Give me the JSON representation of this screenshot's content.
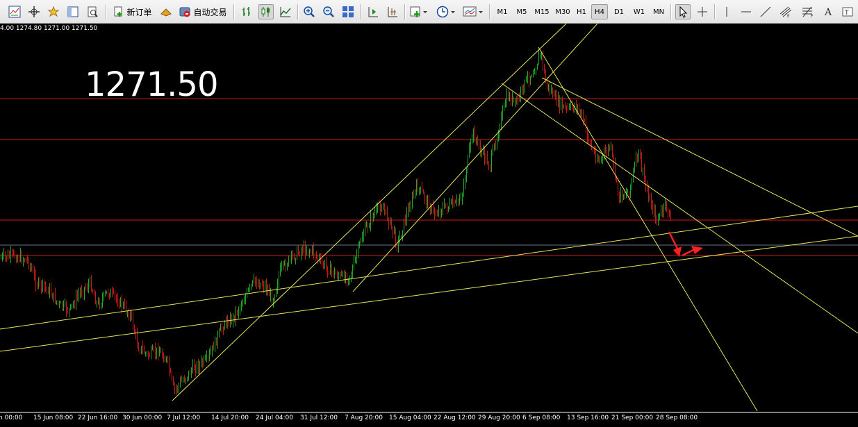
{
  "toolbar": {
    "new_order_label": "新订单",
    "auto_trade_label": "自动交易",
    "timeframes": [
      "M1",
      "M5",
      "M15",
      "M30",
      "H1",
      "H4",
      "D1",
      "W1",
      "MN"
    ],
    "active_timeframe": "H4"
  },
  "chart": {
    "ohlc_text": "4.00 1274.80 1271.00 1271.50",
    "big_price": "1271.50",
    "date_labels": [
      "n 00:00",
      "15 Jun 08:00",
      "22 Jun 16:00",
      "30 Jun 00:00",
      "7 Jul 12:00",
      "14 Jul 20:00",
      "24 Jul 04:00",
      "31 Jul 12:00",
      "7 Aug 20:00",
      "15 Aug 04:00",
      "22 Aug 12:00",
      "29 Aug 20:00",
      "6 Sep 08:00",
      "13 Sep 16:00",
      "21 Sep 00:00",
      "28 Sep 08:00"
    ],
    "colors": {
      "background": "#000000",
      "bull": "#1fa82a",
      "bear": "#c81818",
      "trendline": "#e6e65a",
      "horizontal": "#d01818",
      "bid": "#6e6e8c",
      "arrow": "#ff2020"
    }
  }
}
